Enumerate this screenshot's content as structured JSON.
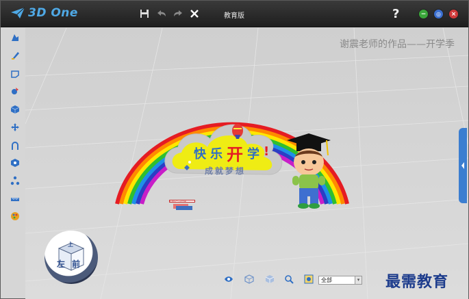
{
  "app": {
    "logo_text": "3D One",
    "edition": "教育版",
    "help": "?"
  },
  "title_actions": [
    "save-icon",
    "undo-icon",
    "redo-icon",
    "close-icon"
  ],
  "window_controls": {
    "minimize": "−",
    "restore": "◎",
    "close": "×"
  },
  "left_tools": [
    "sketch-icon",
    "sketch-edit-icon",
    "shape-icon",
    "feature-icon",
    "combine-icon",
    "move-icon",
    "curve-icon",
    "surface-icon",
    "assembly-icon",
    "measure-icon",
    "material-icon"
  ],
  "canvas": {
    "watermark": "谢震老师的作品——开学季",
    "sign_main": [
      "快",
      "乐",
      "开",
      "学",
      "!"
    ],
    "sign_sub": "成就梦想",
    "small_label": "生而为了一切可能",
    "view_cube": {
      "top": "上",
      "left": "左",
      "front": "前"
    }
  },
  "bottom_bar": {
    "icons": [
      "eye-icon",
      "cube-view-icon",
      "wireframe-icon",
      "zoom-icon",
      "render-icon"
    ],
    "filter_value": "全部"
  },
  "brand": "最需教育",
  "colors": {
    "accent": "#3b7ed0",
    "titlebar": "#2a2a2a",
    "canvas": "#d7d7d7"
  }
}
